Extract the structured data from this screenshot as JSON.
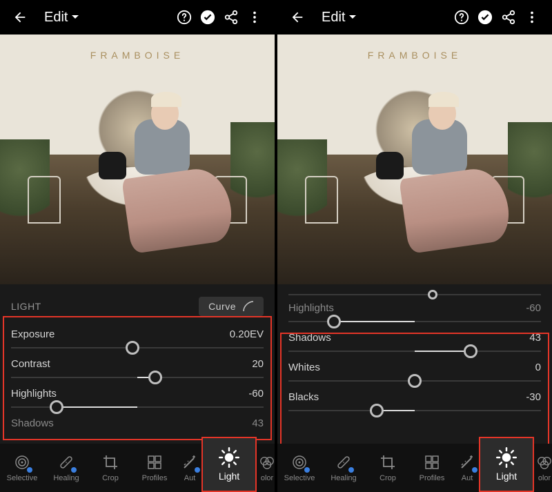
{
  "header": {
    "title": "Edit",
    "back_icon": "arrow-left",
    "actions": [
      "help",
      "confirm",
      "share",
      "more"
    ]
  },
  "photo": {
    "visible_text": "FRAMBOISE"
  },
  "left": {
    "section_label": "LIGHT",
    "curve_label": "Curve",
    "sliders": [
      {
        "label": "Exposure",
        "value": "0.20EV",
        "pct": 48,
        "center": 50,
        "dir": "left"
      },
      {
        "label": "Contrast",
        "value": "20",
        "pct": 57,
        "center": 50,
        "dir": "right"
      },
      {
        "label": "Highlights",
        "value": "-60",
        "pct": 18,
        "center": 50,
        "dir": "left"
      }
    ],
    "below": {
      "label": "Shadows",
      "value": "43"
    }
  },
  "right": {
    "sliders": [
      {
        "label": "Highlights",
        "value": "-60",
        "pct": 18,
        "center": 50,
        "dir": "left",
        "faded": true
      },
      {
        "label": "Shadows",
        "value": "43",
        "pct": 72,
        "center": 50,
        "dir": "right"
      },
      {
        "label": "Whites",
        "value": "0",
        "pct": 50,
        "center": 50,
        "dir": "none"
      },
      {
        "label": "Blacks",
        "value": "-30",
        "pct": 35,
        "center": 50,
        "dir": "left"
      }
    ]
  },
  "bottombar": {
    "tools": [
      {
        "label": "Selective",
        "icon": "target",
        "dot": true
      },
      {
        "label": "Healing",
        "icon": "bandage",
        "dot": true
      },
      {
        "label": "Crop",
        "icon": "crop",
        "dot": false
      },
      {
        "label": "Profiles",
        "icon": "grid",
        "dot": false
      },
      {
        "label": "Auto",
        "icon": "wand",
        "dot": true,
        "cut": true
      }
    ],
    "active": {
      "label": "Light",
      "icon": "brightness"
    },
    "trailing": {
      "label": "olor"
    }
  }
}
